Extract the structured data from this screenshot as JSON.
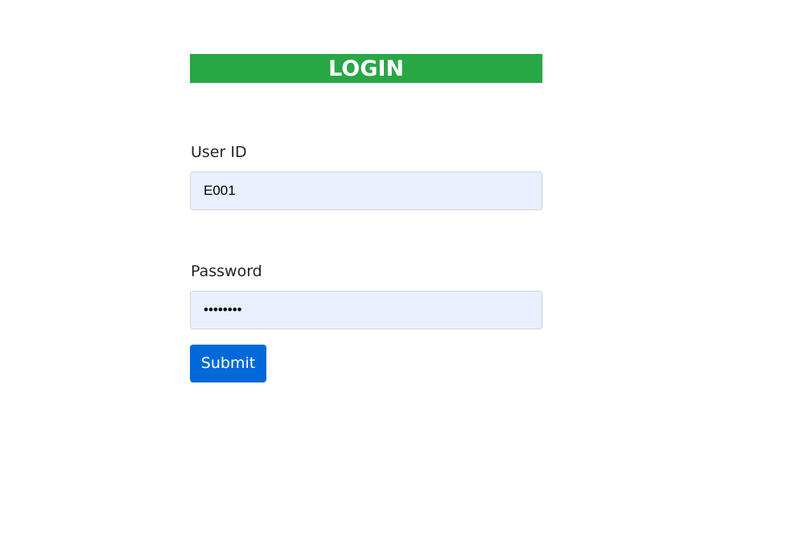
{
  "header": {
    "title": "LOGIN"
  },
  "form": {
    "user_id": {
      "label": "User ID",
      "value": "E001"
    },
    "password": {
      "label": "Password",
      "value": "••••••••"
    },
    "submit_label": "Submit"
  },
  "colors": {
    "header_bg": "#28a745",
    "input_bg": "#e8f0fe",
    "button_bg": "#0069d9"
  }
}
